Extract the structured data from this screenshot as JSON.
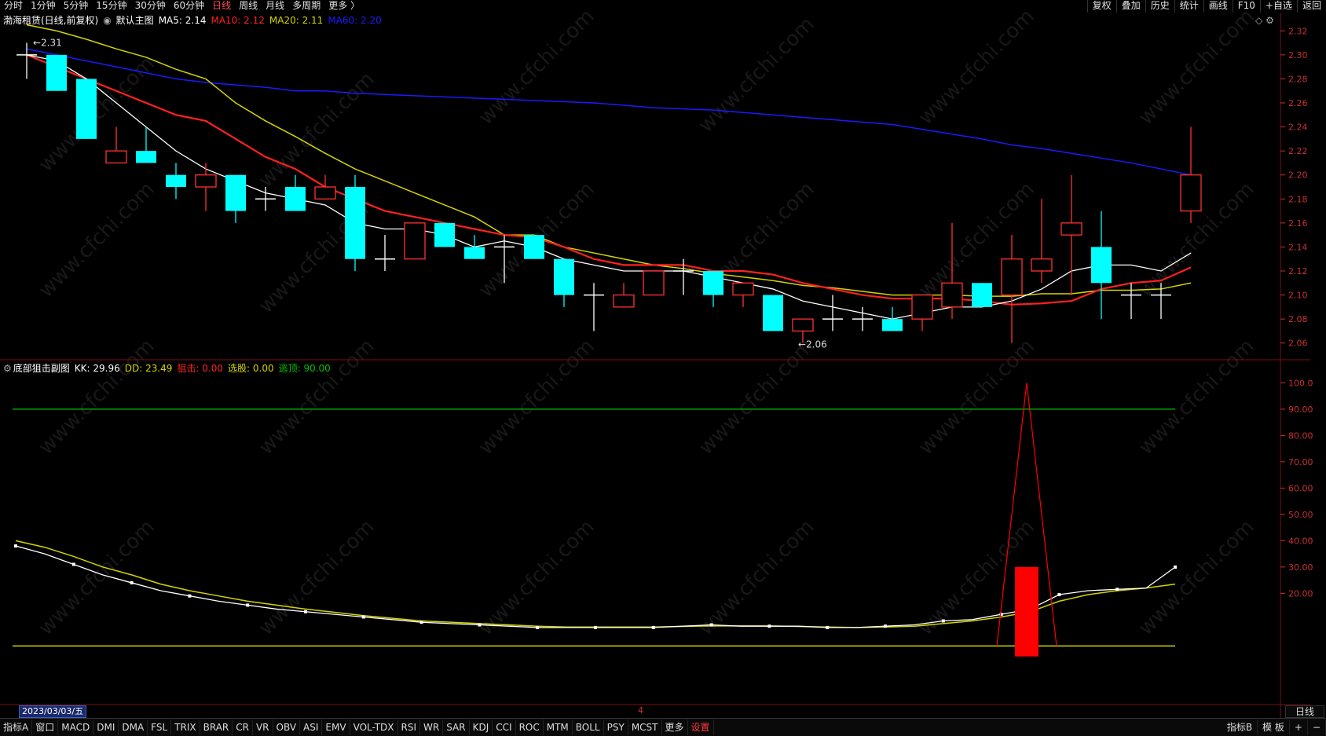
{
  "topbar": {
    "left_items": [
      "分时",
      "1分钟",
      "5分钟",
      "15分钟",
      "30分钟",
      "60分钟",
      "日线",
      "周线",
      "月线",
      "多周期",
      "更多 〉"
    ],
    "active": "日线",
    "right_items": [
      "复权",
      "叠加",
      "历史",
      "统计",
      "画线",
      "F10",
      "+自选",
      "返回"
    ]
  },
  "main_info": {
    "stock": "渤海租赁(日线,前复权)",
    "indicator": "默认主图",
    "ma5_label": "MA5: 2.14",
    "ma10_label": "MA10: 2.12",
    "ma20_label": "MA20: 2.11",
    "ma60_label": "MA60: 2.20",
    "high_label": "2.31",
    "low_label": "←2.06"
  },
  "sub_info": {
    "indicator": "底部狙击副图",
    "kk": "KK: 29.96",
    "dd": "DD: 23.49",
    "jj": "狙击: 0.00",
    "xg": "选股: 0.00",
    "td": "逃顶: 90.00"
  },
  "date_cursor": "2023/03/03/五",
  "month_marker": "4",
  "period_label": "日线",
  "bottombar": {
    "items": [
      "指标A",
      "窗口",
      "MACD",
      "DMI",
      "DMA",
      "FSL",
      "TRIX",
      "BRAR",
      "CR",
      "VR",
      "OBV",
      "ASI",
      "EMV",
      "VOL-TDX",
      "RSI",
      "WR",
      "SAR",
      "KDJ",
      "CCI",
      "ROC",
      "MTM",
      "BOLL",
      "PSY",
      "MCST",
      "更多",
      "设置"
    ],
    "right_items": [
      "指标B",
      "模 板",
      "+",
      "−"
    ]
  },
  "watermark_text": "www.cfchi.com",
  "colors": {
    "up": "#ff3232",
    "down": "#00ffff",
    "ma5": "#ffffff",
    "ma10": "#ff2020",
    "ma20": "#d4d400",
    "ma60": "#1a1aff",
    "kk": "#ffffff",
    "dd": "#d4d400",
    "td_line": "#00c000",
    "base_line": "#d4d400",
    "signal": "#ff0000"
  },
  "chart_data": [
    {
      "type": "candlestick",
      "title": "渤海租赁(日线,前复权)",
      "ylim": [
        2.05,
        2.33
      ],
      "yticks": [
        2.06,
        2.08,
        2.1,
        2.12,
        2.14,
        2.16,
        2.18,
        2.2,
        2.22,
        2.24,
        2.26,
        2.28,
        2.3,
        2.32
      ],
      "candles": [
        {
          "o": 2.3,
          "h": 2.31,
          "l": 2.28,
          "c": 2.3
        },
        {
          "o": 2.3,
          "h": 2.3,
          "l": 2.27,
          "c": 2.27
        },
        {
          "o": 2.28,
          "h": 2.28,
          "l": 2.23,
          "c": 2.23
        },
        {
          "o": 2.21,
          "h": 2.24,
          "l": 2.21,
          "c": 2.22
        },
        {
          "o": 2.22,
          "h": 2.24,
          "l": 2.21,
          "c": 2.21
        },
        {
          "o": 2.2,
          "h": 2.21,
          "l": 2.18,
          "c": 2.19
        },
        {
          "o": 2.19,
          "h": 2.21,
          "l": 2.17,
          "c": 2.2
        },
        {
          "o": 2.2,
          "h": 2.2,
          "l": 2.16,
          "c": 2.17
        },
        {
          "o": 2.18,
          "h": 2.19,
          "l": 2.17,
          "c": 2.18
        },
        {
          "o": 2.19,
          "h": 2.2,
          "l": 2.17,
          "c": 2.17
        },
        {
          "o": 2.18,
          "h": 2.2,
          "l": 2.18,
          "c": 2.19
        },
        {
          "o": 2.19,
          "h": 2.2,
          "l": 2.12,
          "c": 2.13
        },
        {
          "o": 2.13,
          "h": 2.15,
          "l": 2.12,
          "c": 2.13
        },
        {
          "o": 2.13,
          "h": 2.16,
          "l": 2.13,
          "c": 2.16
        },
        {
          "o": 2.16,
          "h": 2.16,
          "l": 2.14,
          "c": 2.14
        },
        {
          "o": 2.14,
          "h": 2.15,
          "l": 2.13,
          "c": 2.13
        },
        {
          "o": 2.14,
          "h": 2.15,
          "l": 2.11,
          "c": 2.14
        },
        {
          "o": 2.15,
          "h": 2.15,
          "l": 2.13,
          "c": 2.13
        },
        {
          "o": 2.13,
          "h": 2.13,
          "l": 2.09,
          "c": 2.1
        },
        {
          "o": 2.1,
          "h": 2.11,
          "l": 2.07,
          "c": 2.1
        },
        {
          "o": 2.09,
          "h": 2.11,
          "l": 2.09,
          "c": 2.1
        },
        {
          "o": 2.1,
          "h": 2.12,
          "l": 2.1,
          "c": 2.12
        },
        {
          "o": 2.12,
          "h": 2.13,
          "l": 2.1,
          "c": 2.12
        },
        {
          "o": 2.12,
          "h": 2.12,
          "l": 2.09,
          "c": 2.1
        },
        {
          "o": 2.1,
          "h": 2.11,
          "l": 2.09,
          "c": 2.11
        },
        {
          "o": 2.1,
          "h": 2.1,
          "l": 2.07,
          "c": 2.07
        },
        {
          "o": 2.07,
          "h": 2.08,
          "l": 2.06,
          "c": 2.08
        },
        {
          "o": 2.08,
          "h": 2.1,
          "l": 2.07,
          "c": 2.08
        },
        {
          "o": 2.08,
          "h": 2.09,
          "l": 2.07,
          "c": 2.08
        },
        {
          "o": 2.08,
          "h": 2.09,
          "l": 2.07,
          "c": 2.07
        },
        {
          "o": 2.08,
          "h": 2.1,
          "l": 2.07,
          "c": 2.1
        },
        {
          "o": 2.09,
          "h": 2.16,
          "l": 2.08,
          "c": 2.11
        },
        {
          "o": 2.11,
          "h": 2.11,
          "l": 2.09,
          "c": 2.09
        },
        {
          "o": 2.1,
          "h": 2.15,
          "l": 2.06,
          "c": 2.13
        },
        {
          "o": 2.12,
          "h": 2.18,
          "l": 2.11,
          "c": 2.13
        },
        {
          "o": 2.15,
          "h": 2.2,
          "l": 2.1,
          "c": 2.16
        },
        {
          "o": 2.14,
          "h": 2.17,
          "l": 2.08,
          "c": 2.11
        },
        {
          "o": 2.1,
          "h": 2.11,
          "l": 2.08,
          "c": 2.1
        },
        {
          "o": 2.1,
          "h": 2.11,
          "l": 2.08,
          "c": 2.1
        },
        {
          "o": 2.17,
          "h": 2.24,
          "l": 2.16,
          "c": 2.2
        }
      ],
      "ma5": [
        2.3,
        2.295,
        2.28,
        2.26,
        2.24,
        2.22,
        2.205,
        2.195,
        2.185,
        2.18,
        2.175,
        2.16,
        2.155,
        2.155,
        2.15,
        2.14,
        2.145,
        2.14,
        2.13,
        2.125,
        2.12,
        2.12,
        2.12,
        2.115,
        2.11,
        2.105,
        2.095,
        2.09,
        2.085,
        2.08,
        2.085,
        2.09,
        2.09,
        2.095,
        2.105,
        2.12,
        2.125,
        2.125,
        2.12,
        2.135
      ],
      "ma10": [
        2.3,
        2.29,
        2.28,
        2.27,
        2.26,
        2.25,
        2.245,
        2.23,
        2.215,
        2.205,
        2.19,
        2.18,
        2.17,
        2.165,
        2.16,
        2.155,
        2.15,
        2.148,
        2.14,
        2.13,
        2.125,
        2.125,
        2.125,
        2.12,
        2.12,
        2.117,
        2.11,
        2.105,
        2.1,
        2.097,
        2.097,
        2.097,
        2.095,
        2.092,
        2.093,
        2.095,
        2.105,
        2.11,
        2.112,
        2.123
      ],
      "ma20": [
        2.325,
        2.32,
        2.313,
        2.305,
        2.298,
        2.288,
        2.28,
        2.26,
        2.245,
        2.232,
        2.218,
        2.205,
        2.195,
        2.185,
        2.175,
        2.165,
        2.15,
        2.15,
        2.14,
        2.135,
        2.13,
        2.125,
        2.122,
        2.118,
        2.115,
        2.112,
        2.108,
        2.106,
        2.103,
        2.1,
        2.1,
        2.1,
        2.099,
        2.099,
        2.101,
        2.101,
        2.104,
        2.104,
        2.105,
        2.11
      ],
      "ma60": [
        2.305,
        2.3,
        2.295,
        2.29,
        2.285,
        2.28,
        2.277,
        2.275,
        2.273,
        2.27,
        2.27,
        2.268,
        2.267,
        2.266,
        2.265,
        2.264,
        2.263,
        2.262,
        2.261,
        2.26,
        2.258,
        2.256,
        2.255,
        2.254,
        2.252,
        2.25,
        2.248,
        2.246,
        2.244,
        2.242,
        2.238,
        2.234,
        2.23,
        2.225,
        2.222,
        2.218,
        2.214,
        2.21,
        2.205,
        2.2
      ]
    },
    {
      "type": "line",
      "title": "底部狙击副图",
      "ylim": [
        -22,
        104
      ],
      "yticks": [
        20,
        30,
        40,
        50,
        60,
        70,
        80,
        90,
        100
      ],
      "ytick_labels": [
        "20.00",
        "30.00",
        "40.00",
        "50.00",
        "60.00",
        "70.00",
        "80.00",
        "90.00",
        "100.0"
      ],
      "series": [
        {
          "name": "KK",
          "values": [
            38,
            35,
            31,
            27,
            24,
            21,
            19,
            17,
            15.5,
            14,
            13,
            12,
            11,
            10,
            9,
            8.5,
            8,
            7.5,
            7,
            7,
            7,
            7,
            7,
            7.5,
            8,
            7.5,
            7.5,
            7.5,
            7,
            7,
            7.5,
            8,
            9.5,
            10,
            12,
            14,
            19.5,
            21,
            21.5,
            22,
            29.96
          ]
        },
        {
          "name": "DD",
          "values": [
            40,
            37.5,
            34,
            30,
            27,
            23.5,
            21,
            19,
            17,
            15.5,
            14,
            12.8,
            11.5,
            10.5,
            9.5,
            9,
            8.5,
            8,
            7.5,
            7.2,
            7.2,
            7.2,
            7.2,
            7.4,
            7.6,
            7.6,
            7.6,
            7.4,
            7.2,
            7,
            7.2,
            7.5,
            8.5,
            9.5,
            11,
            13,
            17,
            19.5,
            21,
            22,
            23.49
          ]
        }
      ],
      "lines": {
        "逃顶": 90,
        "base": 0
      },
      "signal": {
        "index": 34,
        "value": 100,
        "bar_top": 30,
        "bar_bottom": -4
      }
    }
  ]
}
